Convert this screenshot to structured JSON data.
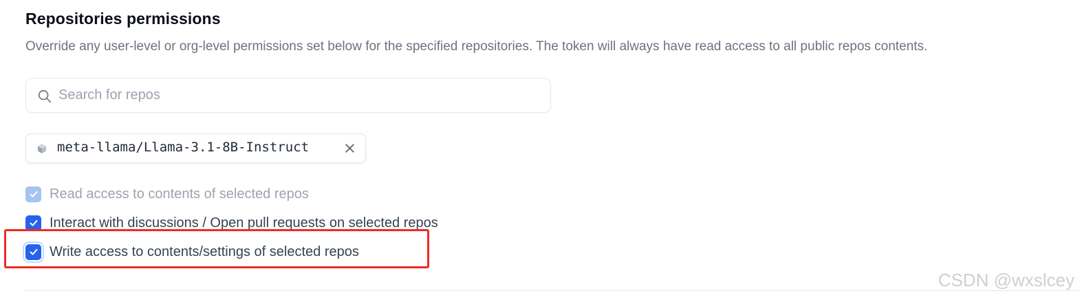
{
  "section": {
    "title": "Repositories permissions",
    "description": "Override any user-level or org-level permissions set below for the specified repositories. The token will always have read access to all public repos contents."
  },
  "search": {
    "placeholder": "Search for repos",
    "value": "",
    "icon": "search-icon"
  },
  "selected_repos": [
    {
      "name": "meta-llama/Llama-3.1-8B-Instruct",
      "icon": "repo-cube-icon",
      "remove_icon": "close-icon"
    }
  ],
  "permissions": [
    {
      "label": "Read access to contents of selected repos",
      "checked": true,
      "disabled": true
    },
    {
      "label": "Interact with discussions / Open pull requests on selected repos",
      "checked": true,
      "disabled": false
    },
    {
      "label": "Write access to contents/settings of selected repos",
      "checked": true,
      "disabled": false,
      "highlighted": true
    }
  ],
  "watermark": "CSDN @wxslcey",
  "colors": {
    "checkbox_checked": "#2563eb",
    "checkbox_disabled": "#a6c3f2",
    "highlight_border": "#ee2a23",
    "description_text": "#6b7280"
  }
}
